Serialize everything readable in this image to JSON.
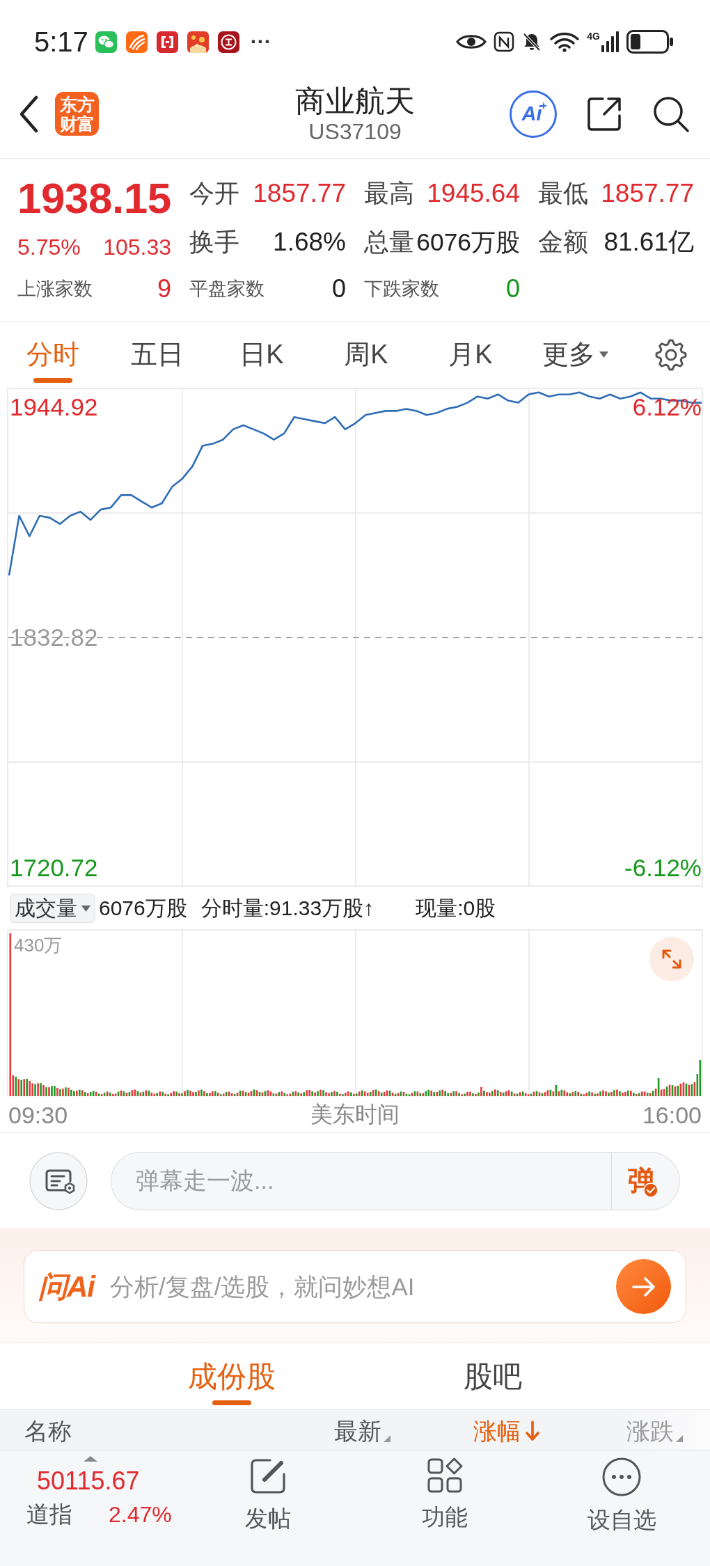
{
  "status_bar": {
    "time": "5:17",
    "more": "···",
    "network": "4G"
  },
  "header": {
    "logo": "东方财富",
    "title": "商业航天",
    "code": "US37109",
    "ai_badge": "Ai"
  },
  "quote": {
    "price": "1938.15",
    "change_pct": "5.75%",
    "change": "105.33",
    "rising": true,
    "stats": [
      {
        "label": "今开",
        "value": "1857.77",
        "color": "#e02a2e"
      },
      {
        "label": "最高",
        "value": "1945.64",
        "color": "#e02a2e"
      },
      {
        "label": "最低",
        "value": "1857.77",
        "color": "#e02a2e"
      },
      {
        "label": "换手",
        "value": "1.68%",
        "color": "#222222"
      },
      {
        "label": "总量",
        "value": "6076万股",
        "color": "#222222"
      },
      {
        "label": "金额",
        "value": "81.61亿",
        "color": "#222222"
      }
    ],
    "breadth": [
      {
        "label": "上涨家数",
        "value": "9",
        "color": "#e02a2e"
      },
      {
        "label": "平盘家数",
        "value": "0",
        "color": "#222222"
      },
      {
        "label": "下跌家数",
        "value": "0",
        "color": "#17981d"
      }
    ]
  },
  "chart_tabs": [
    {
      "label": "分时",
      "selected": true,
      "kind": "tab"
    },
    {
      "label": "五日",
      "selected": false,
      "kind": "tab"
    },
    {
      "label": "日K",
      "selected": false,
      "kind": "tab"
    },
    {
      "label": "周K",
      "selected": false,
      "kind": "tab"
    },
    {
      "label": "月K",
      "selected": false,
      "kind": "tab"
    },
    {
      "label": "更多",
      "selected": false,
      "kind": "menu"
    }
  ],
  "price_chart": {
    "right_labels": [
      {
        "text": "6.12%",
        "color": "#e02a2e"
      },
      {
        "text": "-6.12%",
        "color": "#17981d"
      }
    ],
    "chart_data": {
      "type": "line",
      "grid": true,
      "series": [
        {
          "color": "#2f6db5",
          "values": [
            1863,
            1892,
            1882,
            1892,
            1891,
            1888,
            1892,
            1894,
            1890,
            1895,
            1896,
            1902,
            1902,
            1899,
            1896,
            1898,
            1906,
            1910,
            1916,
            1926,
            1927,
            1929,
            1934,
            1936,
            1934,
            1932,
            1929,
            1932,
            1940,
            1939,
            1938,
            1937,
            1940,
            1934,
            1937,
            1941,
            1942,
            1943,
            1943,
            1944,
            1943,
            1941,
            1942,
            1944,
            1945,
            1947,
            1950,
            1949,
            1951,
            1948,
            1947,
            1951,
            1952,
            1950,
            1951,
            1951,
            1952,
            1950,
            1949,
            1951,
            1949,
            1950,
            1952,
            1949,
            1949,
            1948,
            1948,
            1947,
            1947
          ]
        }
      ],
      "ylim": [
        1711.5,
        1954.3
      ],
      "yticks": [
        {
          "value": 1944.92,
          "label": "1944.92"
        },
        {
          "value": 1720.72,
          "label": "1720.72"
        }
      ],
      "ref_lines": [
        {
          "axis": "y",
          "value": 1832.82,
          "label": "1832.82"
        }
      ]
    }
  },
  "volume": {
    "selector": "成交量",
    "total": "6076万股",
    "minute": "分时量:91.33万股↑",
    "current": "现量:0股",
    "max_label": "430万"
  },
  "time_axis": {
    "start": "09:30",
    "zone": "美东时间",
    "end": "16:00"
  },
  "danmu": {
    "placeholder": "弹幕走一波...",
    "send": "弹"
  },
  "ai_bar": {
    "brand": "问Ai",
    "placeholder": "分析/复盘/选股，就问妙想AI"
  },
  "sub_tabs": [
    {
      "label": "成份股",
      "selected": true
    },
    {
      "label": "股吧",
      "selected": false
    }
  ],
  "table": {
    "columns": [
      {
        "label": "名称",
        "sortable": false,
        "selected": false
      },
      {
        "label": "最新",
        "sortable": true,
        "selected": false
      },
      {
        "label": "涨幅",
        "sortable": true,
        "selected": true
      },
      {
        "label": "涨跌",
        "sortable": true,
        "selected": false
      }
    ]
  },
  "bottom_bar": {
    "index": {
      "value": "50115.67",
      "name": "道指",
      "change": "2.47%",
      "rising": true
    },
    "actions": [
      {
        "label": "发帖",
        "kind": "post"
      },
      {
        "label": "功能",
        "kind": "grid"
      },
      {
        "label": "设自选",
        "kind": "more"
      }
    ]
  }
}
